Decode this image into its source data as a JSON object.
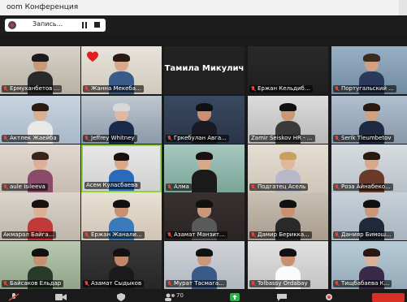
{
  "window": {
    "title": "oom Конференция"
  },
  "recording": {
    "label": "Запись..."
  },
  "toolbar": {
    "participants_count": "70"
  },
  "colors": {
    "speaker_highlight": "#8ed33a",
    "muted_mic": "#e54336",
    "end_button": "#d93025"
  },
  "participants": [
    {
      "name": "Ермуханбетов ...",
      "muted": true
    },
    {
      "name": "Жанна Мекеба...",
      "muted": true
    },
    {
      "name": "Тамила Микулич",
      "muted": false,
      "video_off": true
    },
    {
      "name": "Ержан Кельдиб...",
      "muted": true
    },
    {
      "name": "Португальский ...",
      "muted": true
    },
    {
      "name": "Актлек Жаейба",
      "muted": true
    },
    {
      "name": "Jeffrey Whitney",
      "muted": true
    },
    {
      "name": "Гркебулан Авга...",
      "muted": true
    },
    {
      "name": "Zamir Seiskov HR - ...",
      "muted": false
    },
    {
      "name": "Serik Tleumbetov",
      "muted": true
    },
    {
      "name": "aule Isileeva",
      "muted": true
    },
    {
      "name": "Асем Куласбаева",
      "muted": false,
      "active_speaker": true
    },
    {
      "name": "Алма",
      "muted": true
    },
    {
      "name": "Подгатец Асель",
      "muted": true
    },
    {
      "name": "Роза Айнабеко...",
      "muted": true
    },
    {
      "name": "Акмарал Байга...",
      "muted": false
    },
    {
      "name": "Ержан Жанали...",
      "muted": true
    },
    {
      "name": "Азамат Манзит...",
      "muted": true
    },
    {
      "name": "Дамир Берикка...",
      "muted": true
    },
    {
      "name": "Данияр Бимош...",
      "muted": true
    },
    {
      "name": "Байсаков Ельдар",
      "muted": true
    },
    {
      "name": "Азамат Сыдыков",
      "muted": true
    },
    {
      "name": "Мурат Тасмага...",
      "muted": true
    },
    {
      "name": "Tolbassy Ordabay",
      "muted": true
    },
    {
      "name": "Тищбабаева К...",
      "muted": true
    }
  ]
}
